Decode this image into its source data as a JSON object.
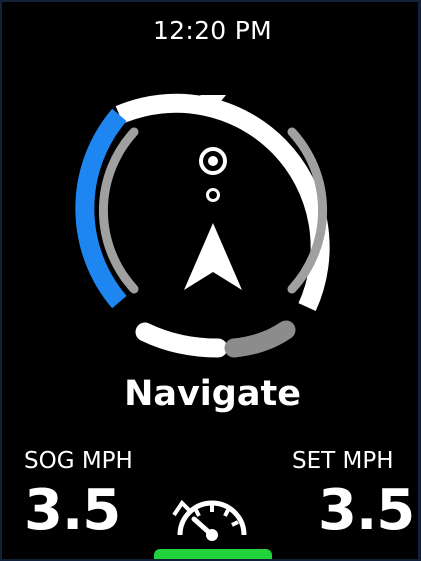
{
  "status": {
    "time": "12:20 PM"
  },
  "mode": {
    "label": "Navigate"
  },
  "left_metric": {
    "label": "SOG MPH",
    "value": "3.5"
  },
  "right_metric": {
    "label": "SET MPH",
    "value": "3.5"
  },
  "icons": {
    "speed_control": "speedometer-icon",
    "heading": "heading-marker-icon",
    "waypoint": "waypoint-target-icon",
    "boat": "boat-arrow-icon"
  },
  "colors": {
    "background": "#000000",
    "accent_blue": "#1e86f0",
    "active_green": "#22d23a",
    "ring_white": "#ffffff",
    "ring_gray": "#9a9a9a"
  }
}
